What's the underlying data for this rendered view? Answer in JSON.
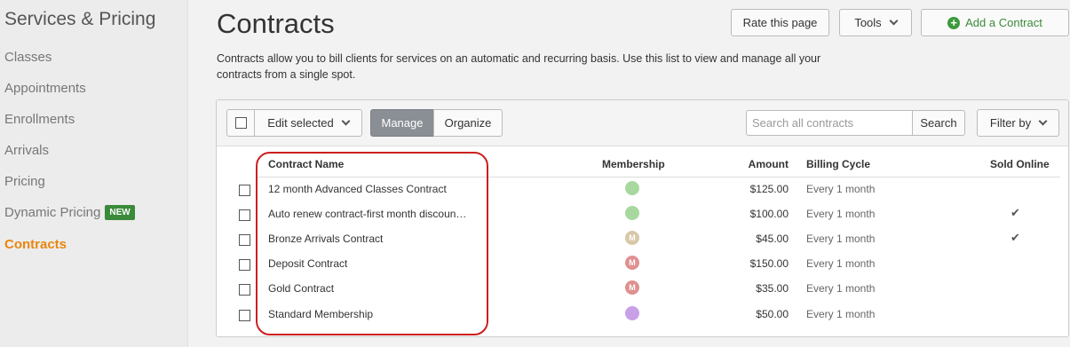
{
  "sidebar": {
    "title": "Services & Pricing",
    "items": [
      {
        "label": "Classes"
      },
      {
        "label": "Appointments"
      },
      {
        "label": "Enrollments"
      },
      {
        "label": "Arrivals"
      },
      {
        "label": "Pricing"
      },
      {
        "label": "Dynamic Pricing",
        "badge": "NEW"
      },
      {
        "label": "Contracts",
        "active": true
      }
    ]
  },
  "page": {
    "title": "Contracts",
    "description": "Contracts allow you to bill clients for services on an automatic and recurring basis. Use this list to view and manage all your contracts from a single spot.",
    "rate_button": "Rate this page",
    "tools_button": "Tools",
    "add_button": "Add a Contract"
  },
  "toolbar": {
    "edit_selected": "Edit selected",
    "manage": "Manage",
    "organize": "Organize",
    "search_placeholder": "Search all contracts",
    "search_button": "Search",
    "filter_button": "Filter by"
  },
  "table": {
    "headers": {
      "name": "Contract Name",
      "membership": "Membership",
      "amount": "Amount",
      "billing_cycle": "Billing Cycle",
      "sold_online": "Sold Online"
    },
    "rows": [
      {
        "name": "12 month Advanced Classes Contract",
        "membership_letter": "",
        "membership_color": "#a8d8a0",
        "amount": "$125.00",
        "billing_cycle": "Every 1 month",
        "sold_online": false
      },
      {
        "name": "Auto renew contract-first month discoun…",
        "membership_letter": "",
        "membership_color": "#a8d8a0",
        "amount": "$100.00",
        "billing_cycle": "Every 1 month",
        "sold_online": true
      },
      {
        "name": "Bronze Arrivals Contract",
        "membership_letter": "M",
        "membership_color": "#d8c8a8",
        "amount": "$45.00",
        "billing_cycle": "Every 1 month",
        "sold_online": true
      },
      {
        "name": "Deposit Contract",
        "membership_letter": "M",
        "membership_color": "#e09090",
        "amount": "$150.00",
        "billing_cycle": "Every 1 month",
        "sold_online": false
      },
      {
        "name": "Gold Contract",
        "membership_letter": "M",
        "membership_color": "#e09090",
        "amount": "$35.00",
        "billing_cycle": "Every 1 month",
        "sold_online": false
      },
      {
        "name": "Standard Membership",
        "membership_letter": "",
        "membership_color": "#c8a0e8",
        "amount": "$50.00",
        "billing_cycle": "Every 1 month",
        "sold_online": false
      }
    ]
  },
  "colors": {
    "accent_orange": "#e8870e",
    "new_badge_green": "#3a8a3a",
    "highlight_red": "#cc1f1f"
  }
}
